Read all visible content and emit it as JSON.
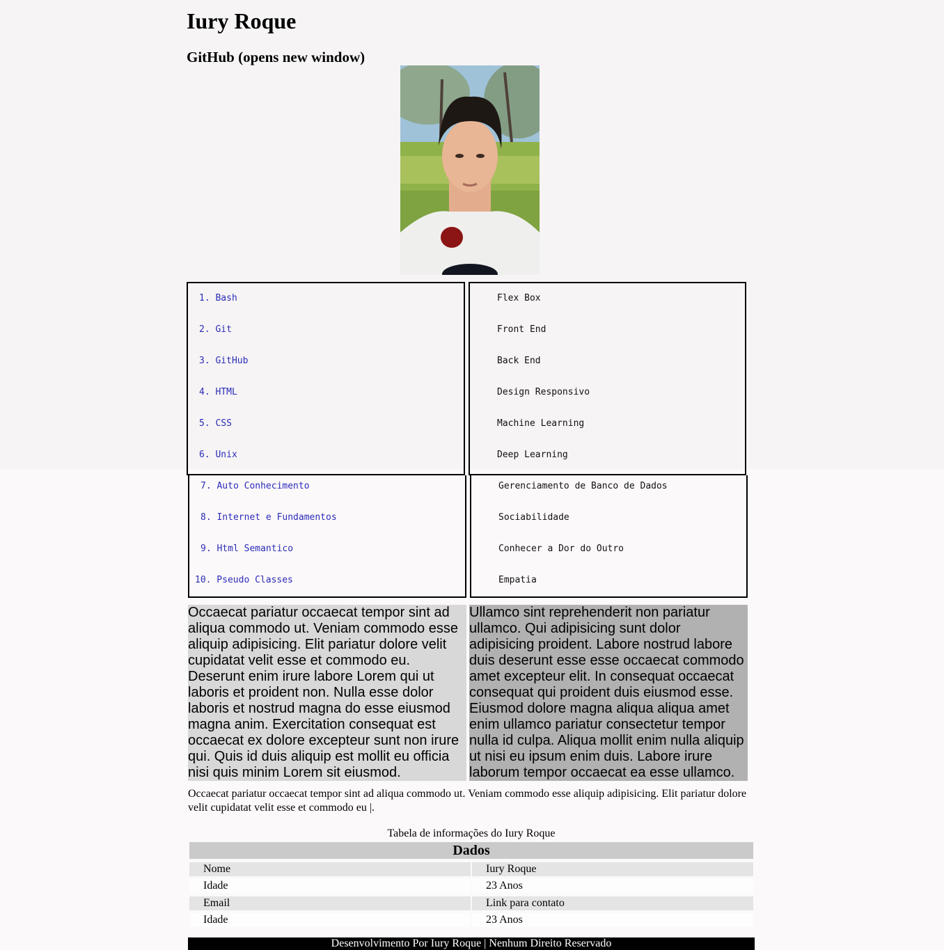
{
  "header": {
    "title": "Iury Roque",
    "subtitle": "GitHub (opens new window)"
  },
  "profile": {
    "photo_alt": "Foto de Iury Roque"
  },
  "lists": {
    "left": [
      "1. Bash",
      "2. Git",
      "3. GitHub",
      "4. HTML",
      "5. CSS",
      "6. Unix",
      "7. Auto Conhecimento",
      "8. Internet e Fundamentos",
      "9. Html Semantico",
      "10. Pseudo Classes"
    ],
    "right": [
      "Flex Box",
      "Front End",
      "Back End",
      "Design Responsivo",
      "Machine Learning",
      "Deep Learning",
      "Gerenciamento de Banco de Dados",
      "Sociabilidade",
      "Conhecer a Dor do Outro",
      "Empatia"
    ]
  },
  "paragraphs": {
    "left": "Occaecat pariatur occaecat tempor sint ad aliqua commodo ut. Veniam commodo esse aliquip adipisicing. Elit pariatur dolore velit cupidatat velit esse et commodo eu. Deserunt enim irure labore Lorem qui ut laboris et proident non. Nulla esse dolor laboris et nostrud magna do esse eiusmod magna anim. Exercitation consequat est occaecat ex dolore excepteur sunt non irure qui. Quis id duis aliquip est mollit eu officia nisi quis minim Lorem sit eiusmod.",
    "right": "Ullamco sint reprehenderit non pariatur ullamco. Qui adipisicing sunt dolor adipisicing proident. Labore nostrud labore duis deserunt esse esse occaecat commodo amet excepteur elit. In consequat occaecat consequat qui proident duis eiusmod esse. Eiusmod dolore magna aliqua aliqua amet enim ullamco pariatur consectetur tempor nulla id culpa. Aliqua mollit enim nulla aliquip ut nisi eu ipsum enim duis. Labore irure laborum tempor occaecat ea esse ullamco.",
    "plain": "Occaecat pariatur occaecat tempor sint ad aliqua commodo ut. Veniam commodo esse aliquip adipisicing. Elit pariatur dolore velit cupidatat velit esse et commodo eu |."
  },
  "table": {
    "caption": "Tabela de informações do Iury Roque",
    "header": "Dados",
    "rows": [
      [
        "Nome",
        "Iury Roque"
      ],
      [
        "Idade",
        "23 Anos"
      ],
      [
        "Email",
        "Link para contato"
      ],
      [
        "Idade",
        "23 Anos"
      ]
    ]
  },
  "footer": {
    "text": "Desenvolvimento Por Iury Roque | Nenhum Direito Reservado"
  },
  "colors": {
    "link": "#2b2bb8",
    "page_background": "#fcf9fa",
    "footer_background": "#000000"
  }
}
